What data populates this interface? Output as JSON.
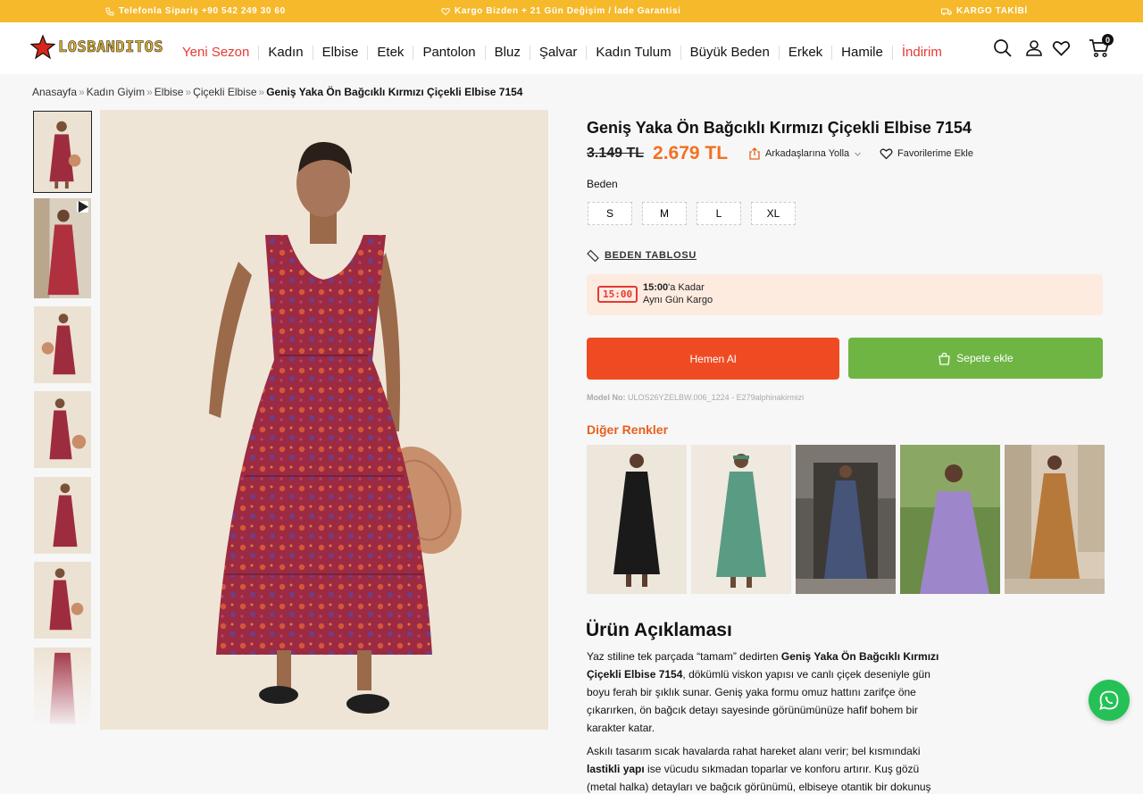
{
  "topbar": {
    "phone": "Telefonla Sipariş +90 542 249 30 60",
    "shipping": "Kargo Bizden + 21 Gün Değişim / İade Garantisi",
    "tracking": "KARGO TAKİBİ",
    "bg_color": "#f6b92b"
  },
  "header": {
    "logo_text": "LOSBANDITOS",
    "nav": [
      {
        "label": "Yeni Sezon",
        "accent": true
      },
      {
        "label": "Kadın"
      },
      {
        "label": "Elbise"
      },
      {
        "label": "Etek"
      },
      {
        "label": "Pantolon"
      },
      {
        "label": "Bluz"
      },
      {
        "label": "Şalvar"
      },
      {
        "label": "Kadın Tulum"
      },
      {
        "label": "Büyük Beden"
      },
      {
        "label": "Erkek"
      },
      {
        "label": "Hamile"
      },
      {
        "label": "İndirim",
        "accent": true
      }
    ],
    "cart_count": "0",
    "icons": [
      "search-icon",
      "user-icon",
      "heart-icon",
      "cart-icon"
    ]
  },
  "breadcrumb": {
    "items": [
      "Anasayfa",
      "Kadın Giyim",
      "Elbise",
      "Çiçekli Elbise"
    ],
    "current": "Geniş Yaka Ön Bağcıklı Kırmızı Çiçekli Elbise 7154",
    "separator": "»"
  },
  "product": {
    "title": "Geniş Yaka Ön Bağcıklı Kırmızı Çiçekli Elbise 7154",
    "old_price": "3.149 TL",
    "new_price": "2.679 TL",
    "share_label": "Arkadaşlarına Yolla",
    "favorite_label": "Favorilerime Ekle",
    "size_label": "Beden",
    "sizes": [
      "S",
      "M",
      "L",
      "XL"
    ],
    "size_table_label": "BEDEN TABLOSU",
    "delivery_time": "15:00",
    "delivery_bold": "15:00",
    "delivery_line1_suffix": "'a Kadar",
    "delivery_line2": "Aynı Gün Kargo",
    "buy_now_label": "Hemen Al",
    "add_to_cart_label": "Sepete ekle",
    "model_no_label": "Model No:",
    "model_no_value": "ULOS26YZELBW.006_1224 - E279alphinakirmizi",
    "other_colors_label": "Diğer Renkler",
    "accent_color": "#f37021",
    "buy_color": "#ef4b23",
    "cart_color": "#6fb543"
  },
  "thumbnails": {
    "count": 7,
    "video_index": 1
  },
  "other_colors": [
    {
      "name": "black"
    },
    {
      "name": "green"
    },
    {
      "name": "navy"
    },
    {
      "name": "lilac"
    },
    {
      "name": "mustard"
    }
  ],
  "description": {
    "title": "Ürün Açıklaması",
    "p1_a": "Yaz stiline tek parçada “tamam” dedirten ",
    "p1_b": "Geniş Yaka Ön Bağcıklı Kırmızı Çiçekli Elbise 7154",
    "p1_c": ", dökümlü viskon yapısı ve canlı çiçek deseniyle gün boyu ferah bir şıklık sunar. Geniş yaka formu omuz hattını zarifçe öne çıkarırken, ön bağcık detayı sayesinde görünümünüze hafif bohem bir karakter katar.",
    "p2_a": "Askılı tasarım sıcak havalarda rahat hareket alanı verir; bel kısmındaki ",
    "p2_b": "lastikli yapı",
    "p2_c": " ise vücudu sıkmadan toparlar ve konforu artırır. Kuş gözü (metal halka) detayları ve bağcık görünümü, elbiseye otantik bir dokunuş"
  }
}
